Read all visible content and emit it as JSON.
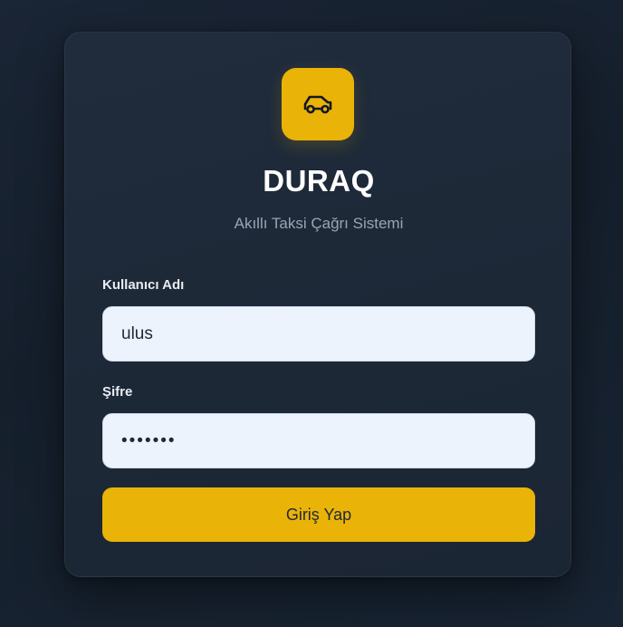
{
  "app": {
    "title": "DURAQ",
    "subtitle": "Akıllı Taksi Çağrı Sistemi",
    "logo_icon": "car-icon",
    "accent_color": "#eab308"
  },
  "form": {
    "username": {
      "label": "Kullanıcı Adı",
      "value": "ulus"
    },
    "password": {
      "label": "Şifre",
      "value": "1234567"
    },
    "submit_label": "Giriş Yap"
  }
}
